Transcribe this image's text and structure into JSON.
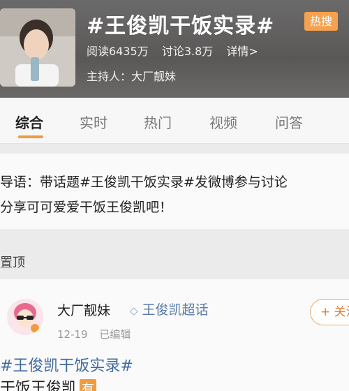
{
  "header": {
    "title": "#王俊凯干饭实录#",
    "hot_badge": "热搜",
    "reads": "阅读6435万",
    "discussions": "讨论3.8万",
    "details_link": "详情>",
    "host": "主持人：大厂靓妹"
  },
  "tabs": [
    {
      "label": "综合",
      "active": true
    },
    {
      "label": "实时",
      "active": false
    },
    {
      "label": "热门",
      "active": false
    },
    {
      "label": "视频",
      "active": false
    },
    {
      "label": "问答",
      "active": false
    }
  ],
  "guide": {
    "line1": "导语：带话题#王俊凯干饭实录#发微博参与讨论",
    "line2": "分享可可爱爱干饭王俊凯吧！"
  },
  "pinned_label": "置顶",
  "post": {
    "author": "大厂靓妹",
    "super_topic": "王俊凯超话",
    "date": "12-19",
    "edited": "已编辑",
    "follow_label": "+ 关注",
    "hashtag": "#王俊凯干饭实录#",
    "text": "干饭王俊凯",
    "text_badge": "有"
  },
  "colors": {
    "accent": "#f29b3c",
    "link": "#3f6aa0",
    "header_bg": "#5a5857"
  }
}
